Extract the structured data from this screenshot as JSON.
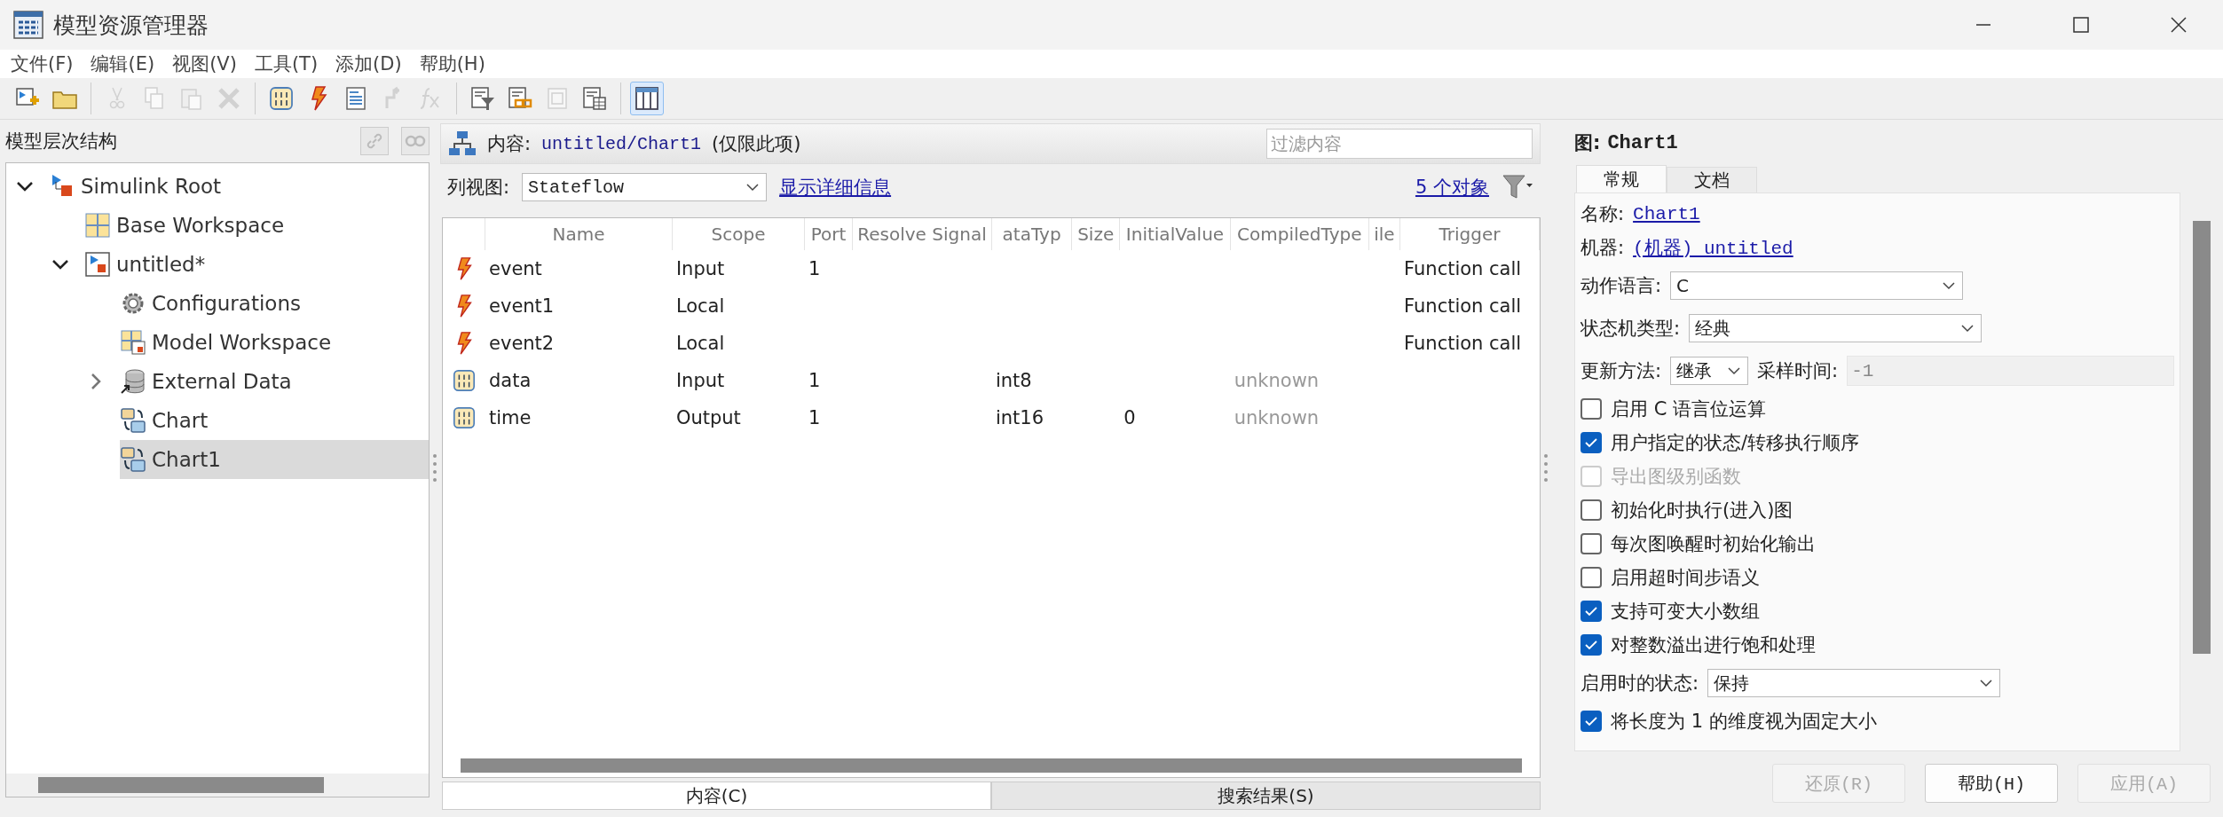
{
  "window": {
    "title": "模型资源管理器"
  },
  "menu": [
    "文件(F)",
    "编辑(E)",
    "视图(V)",
    "工具(T)",
    "添加(D)",
    "帮助(H)"
  ],
  "toolbar": [
    {
      "kind": "new-model",
      "disabled": false,
      "on": false
    },
    {
      "kind": "open",
      "disabled": false,
      "on": false
    },
    {
      "kind": "separator"
    },
    {
      "kind": "cut",
      "disabled": true,
      "on": false
    },
    {
      "kind": "copy",
      "disabled": true,
      "on": false
    },
    {
      "kind": "paste",
      "disabled": true,
      "on": false
    },
    {
      "kind": "delete",
      "disabled": true,
      "on": false
    },
    {
      "kind": "separator"
    },
    {
      "kind": "data",
      "disabled": false,
      "on": false
    },
    {
      "kind": "event",
      "disabled": false,
      "on": false
    },
    {
      "kind": "document",
      "disabled": false,
      "on": false
    },
    {
      "kind": "step",
      "disabled": true,
      "on": false
    },
    {
      "kind": "fx",
      "disabled": true,
      "on": false
    },
    {
      "kind": "separator"
    },
    {
      "kind": "doc-filter",
      "disabled": false,
      "on": false
    },
    {
      "kind": "doc-link",
      "disabled": false,
      "on": false
    },
    {
      "kind": "doc-frame",
      "disabled": true,
      "on": false
    },
    {
      "kind": "doc-table",
      "disabled": false,
      "on": false
    },
    {
      "kind": "separator"
    },
    {
      "kind": "columns",
      "disabled": false,
      "on": true
    }
  ],
  "hierarchy": {
    "title": "模型层次结构",
    "tools": [
      {
        "kind": "link",
        "disabled": true
      },
      {
        "kind": "glasses",
        "disabled": true
      }
    ],
    "tree": [
      {
        "label": "Simulink Root",
        "kind": "root",
        "expanded": true,
        "selected": false,
        "children": [
          {
            "label": "Base Workspace",
            "kind": "workspace",
            "selected": false
          },
          {
            "label": "untitled*",
            "kind": "model",
            "expanded": true,
            "selected": false,
            "children": [
              {
                "label": "Configurations",
                "kind": "config",
                "selected": false
              },
              {
                "label": "Model Workspace",
                "kind": "model-workspace",
                "selected": false
              },
              {
                "label": "External Data",
                "kind": "database",
                "expanded": false,
                "selected": false
              },
              {
                "label": "Chart",
                "kind": "chart",
                "selected": false
              },
              {
                "label": "Chart1",
                "kind": "chart",
                "selected": true
              }
            ]
          }
        ]
      }
    ]
  },
  "content": {
    "label": "内容:",
    "path": "untitled/Chart1",
    "scope_note": "(仅限此项)",
    "filter": {
      "placeholder": "过滤内容"
    },
    "view_label": "列视图:",
    "view": "Stateflow",
    "details_link": "显示详细信息",
    "count_link": "5 个对象"
  },
  "table": {
    "columns": [
      "Name",
      "Scope",
      "Port",
      "Resolve Signal",
      "ataTyp",
      "Size",
      "InitialValue",
      "CompiledType",
      "ile",
      "Trigger"
    ],
    "rows": [
      {
        "kind": "event",
        "name": "event",
        "scope": "Input",
        "port": "1",
        "trigger": "Function call"
      },
      {
        "kind": "event",
        "name": "event1",
        "scope": "Local",
        "trigger": "Function call"
      },
      {
        "kind": "event",
        "name": "event2",
        "scope": "Local",
        "trigger": "Function call"
      },
      {
        "kind": "data",
        "name": "data",
        "scope": "Input",
        "port": "1",
        "datatype": "int8",
        "compiled_type": "unknown"
      },
      {
        "kind": "data",
        "name": "time",
        "scope": "Output",
        "port": "1",
        "datatype": "int16",
        "initial_value": "0",
        "compiled_type": "unknown"
      }
    ]
  },
  "bottom_tabs": [
    {
      "label": "内容(C)",
      "selected": true
    },
    {
      "label": "搜索结果(S)",
      "selected": false
    }
  ],
  "properties": {
    "title_label": "图:",
    "title": "Chart1",
    "tabs": [
      {
        "label": "常规",
        "selected": true
      },
      {
        "label": "文档",
        "selected": false
      }
    ],
    "items": [
      {
        "kind": "link",
        "label": "名称:",
        "value": "Chart1"
      },
      {
        "kind": "link",
        "label": "机器:",
        "value": "(机器) untitled"
      },
      {
        "kind": "dropdown",
        "label": "动作语言:",
        "value": "C"
      },
      {
        "kind": "dropdown",
        "label": "状态机类型:",
        "value": "经典"
      },
      {
        "kind": "update",
        "label": "更新方法:",
        "value": "继承",
        "sample_label": "采样时间:",
        "sample_value": "-1"
      },
      {
        "kind": "checkbox",
        "label": "启用 C 语言位运算",
        "checked": false,
        "disabled": false
      },
      {
        "kind": "checkbox",
        "label": "用户指定的状态/转移执行顺序",
        "checked": true,
        "disabled": false
      },
      {
        "kind": "checkbox",
        "label": "导出图级别函数",
        "checked": false,
        "disabled": true
      },
      {
        "kind": "checkbox",
        "label": "初始化时执行(进入)图",
        "checked": false,
        "disabled": false
      },
      {
        "kind": "checkbox",
        "label": "每次图唤醒时初始化输出",
        "checked": false,
        "disabled": false
      },
      {
        "kind": "checkbox",
        "label": "启用超时间步语义",
        "checked": false,
        "disabled": false
      },
      {
        "kind": "checkbox",
        "label": "支持可变大小数组",
        "checked": true,
        "disabled": false
      },
      {
        "kind": "checkbox",
        "label": "对整数溢出进行饱和处理",
        "checked": true,
        "disabled": false
      },
      {
        "kind": "dropdown",
        "label": "启用时的状态:",
        "value": "保持"
      },
      {
        "kind": "checkbox",
        "label": "将长度为 1 的维度视为固定大小",
        "checked": true,
        "disabled": false
      }
    ],
    "buttons": [
      {
        "label": "还原(R)",
        "disabled": true
      },
      {
        "label": "帮助(H)",
        "disabled": false
      },
      {
        "label": "应用(A)",
        "disabled": true
      }
    ]
  }
}
